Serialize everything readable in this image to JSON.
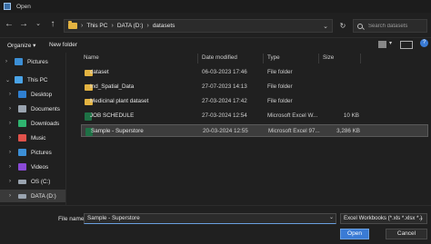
{
  "window": {
    "title": "Open"
  },
  "nav": {
    "breadcrumb": [
      "This PC",
      "DATA (D:)",
      "datasets"
    ],
    "search_placeholder": "Search datasets"
  },
  "commands": {
    "organize": "Organize ▾",
    "new_folder": "New folder"
  },
  "sidebar": {
    "items": [
      {
        "label": "Pictures",
        "icon": "pictures-icon",
        "color": "#3c8fd6"
      },
      {
        "label": "This PC",
        "icon": "pc-icon",
        "color": "#4aa3e6"
      },
      {
        "label": "Desktop",
        "icon": "desktop-icon",
        "color": "#2f80d1"
      },
      {
        "label": "Documents",
        "icon": "documents-icon",
        "color": "#9aa4b0"
      },
      {
        "label": "Downloads",
        "icon": "downloads-icon",
        "color": "#2fb36f"
      },
      {
        "label": "Music",
        "icon": "music-icon",
        "color": "#e0524b"
      },
      {
        "label": "Pictures",
        "icon": "pictures-icon",
        "color": "#3c8fd6"
      },
      {
        "label": "Videos",
        "icon": "videos-icon",
        "color": "#8a4ad6"
      },
      {
        "label": "OS (C:)",
        "icon": "drive-icon",
        "color": "#9aa4b0"
      },
      {
        "label": "DATA (D:)",
        "icon": "drive-icon",
        "color": "#9aa4b0"
      }
    ]
  },
  "columns": {
    "name": "Name",
    "date": "Date modified",
    "type": "Type",
    "size": "Size"
  },
  "files": [
    {
      "name": "dataset",
      "date": "06-03-2023 17:46",
      "type": "File folder",
      "size": "",
      "kind": "folder"
    },
    {
      "name": "Ind_Spatial_Data",
      "date": "27-07-2023 14:13",
      "type": "File folder",
      "size": "",
      "kind": "folder"
    },
    {
      "name": "Medicinal plant dataset",
      "date": "27-03-2024 17:42",
      "type": "File folder",
      "size": "",
      "kind": "folder"
    },
    {
      "name": "JOB SCHEDULE",
      "date": "27-03-2024 12:54",
      "type": "Microsoft Excel W...",
      "size": "10 KB",
      "kind": "excel"
    },
    {
      "name": "Sample - Superstore",
      "date": "20-03-2024 12:55",
      "type": "Microsoft Excel 97...",
      "size": "3,286 KB",
      "kind": "excel"
    }
  ],
  "footer": {
    "file_name_label": "File name:",
    "file_name_value": "Sample - Superstore",
    "file_type": "Excel Workbooks (*.xls *.xlsx *.)",
    "open_label": "Open",
    "cancel_label": "Cancel"
  },
  "colors": {
    "accent": "#3a7bd5",
    "folder": "#e3b341",
    "excel": "#1e7145"
  }
}
